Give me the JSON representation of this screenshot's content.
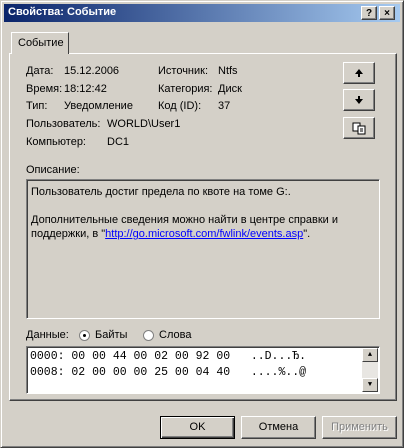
{
  "window": {
    "title": "Свойства: Событие",
    "help_button": "?",
    "close_button": "×"
  },
  "tab": {
    "label": "Событие"
  },
  "event": {
    "date_label": "Дата:",
    "date": "15.12.2006",
    "time_label": "Время:",
    "time": "18:12:42",
    "type_label": "Тип:",
    "type": "Уведомление",
    "user_label": "Пользователь:",
    "user": "WORLD\\User1",
    "computer_label": "Компьютер:",
    "computer": "DC1",
    "source_label": "Источник:",
    "source": "Ntfs",
    "category_label": "Категория:",
    "category": "Диск",
    "code_label": "Код (ID):",
    "code": "37"
  },
  "nav": {
    "up_icon": "arrow-up-icon",
    "down_icon": "arrow-down-icon",
    "copy_icon": "copy-icon"
  },
  "description": {
    "label": "Описание:",
    "line1": "Пользователь достиг предела по квоте на томе G:.",
    "line2": "Дополнительные сведения можно найти в центре справки и поддержки, в \"",
    "link": "http://go.microsoft.com/fwlink/events.asp",
    "line2_end": "\"."
  },
  "data_section": {
    "label": "Данные:",
    "bytes_label": "Байты",
    "words_label": "Слова",
    "selected": "Байты",
    "rows": [
      "0000: 00 00 44 00 02 00 92 00   ..D...Ђ.",
      "0008: 02 00 00 00 25 00 04 40   ....%..@"
    ]
  },
  "buttons": {
    "ok": "OK",
    "cancel": "Отмена",
    "apply": "Применить"
  }
}
